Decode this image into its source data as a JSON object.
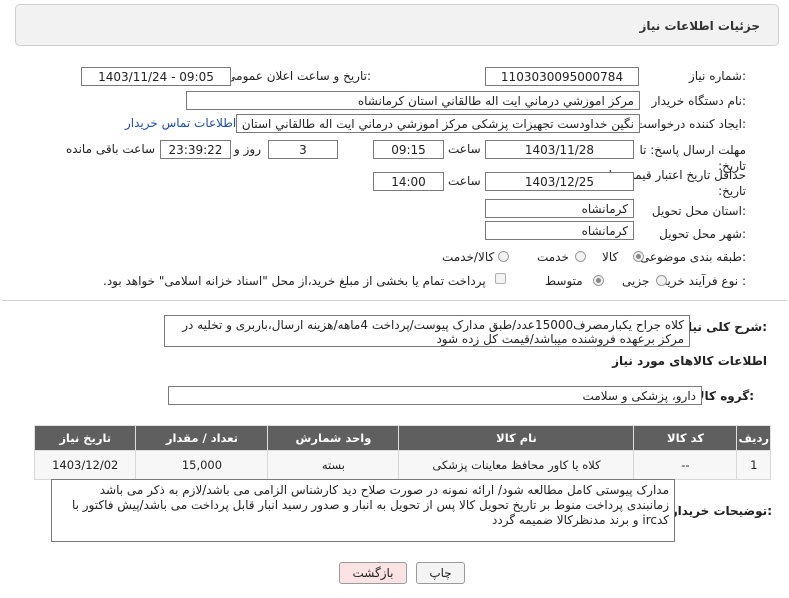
{
  "header": {
    "title": "جزئیات اطلاعات نیاز"
  },
  "fields": {
    "need_number_label": "شماره نیاز:",
    "need_number": "1103030095000784",
    "announce_label": "تاریخ و ساعت اعلان عمومی:",
    "announce_value": "1403/11/24 - 09:05",
    "buyer_org_label": "نام دستگاه خریدار:",
    "buyer_org": "مرکز اموزشي درماني ايت اله طالقاني استان کرمانشاه",
    "requester_label": "ایجاد کننده درخواست:",
    "requester": "نگین خداودست تجهیزات پزشکی مرکز اموزشي درماني ايت اله طالقاني استان",
    "contact_link": "اطلاعات تماس خریدار",
    "reply_deadline_label": "مهلت ارسال پاسخ: تا تاریخ:",
    "reply_date": "1403/11/28",
    "time_label": "ساعت",
    "reply_time": "09:15",
    "days_value": "3",
    "days_label": "روز و",
    "remaining_time": "23:39:22",
    "remaining_label": "ساعت باقی مانده",
    "price_validity_label": "حداقل تاریخ اعتبار قیمت: تا تاریخ:",
    "validity_date": "1403/12/25",
    "validity_time": "14:00",
    "delivery_province_label": "استان محل تحویل:",
    "delivery_province": "کرمانشاه",
    "delivery_city_label": "شهر محل تحویل:",
    "delivery_city": "کرمانشاه",
    "category_label": "طبقه بندی موضوعی:",
    "category_options": [
      "کالا",
      "خدمت",
      "کالا/خدمت"
    ],
    "process_label": "نوع فرآیند خرید :",
    "process_options": [
      "جزیی",
      "متوسط"
    ],
    "payment_note": "پرداخت تمام یا بخشی از مبلغ خرید،از محل \"اسناد خزانه اسلامی\" خواهد بود."
  },
  "description": {
    "label": "شرح کلی نیاز:",
    "text": "کلاه جراح یکبارمصرف15000عدد/طبق مدارک پیوست/پرداخت 4ماهه/هزینه ارسال،باربری و تخلیه در مرکز برعهده فروشنده میباشد/قیمت کل زده شود"
  },
  "goods": {
    "section_title": "اطلاعات کالاهای مورد نیاز",
    "group_label": "گروه کالا:",
    "group_value": "دارو، پزشکی و سلامت",
    "columns": [
      "ردیف",
      "کد کالا",
      "نام کالا",
      "واحد شمارش",
      "تعداد / مقدار",
      "تاریخ نیاز"
    ],
    "rows": [
      [
        "1",
        "--",
        "کلاه یا کاور محافظ معاینات پزشکی",
        "بسته",
        "15,000",
        "1403/12/02"
      ]
    ]
  },
  "buyer_notes": {
    "label": "توضیحات خریدار:",
    "text": "مدارک پیوستی کامل مطالعه شود/ ارائه نمونه در صورت صلاح دید کارشناس الزامی می باشد/لازم به ذکر می باشد زمانبندی پرداخت منوط بر تاریخ تحویل کالا  پس از تحویل به انبار و صدور رسید انبار قابل پرداخت می باشد/پیش فاکتور با کدirc و برند مدنظرکالا ضمیمه گردد"
  },
  "buttons": {
    "print": "چاپ",
    "back": "بازگشت"
  },
  "colors": {
    "link": "#1f4fa3",
    "table_header": "#5f5f5f",
    "back_button_bg": "#fbe3e3"
  }
}
